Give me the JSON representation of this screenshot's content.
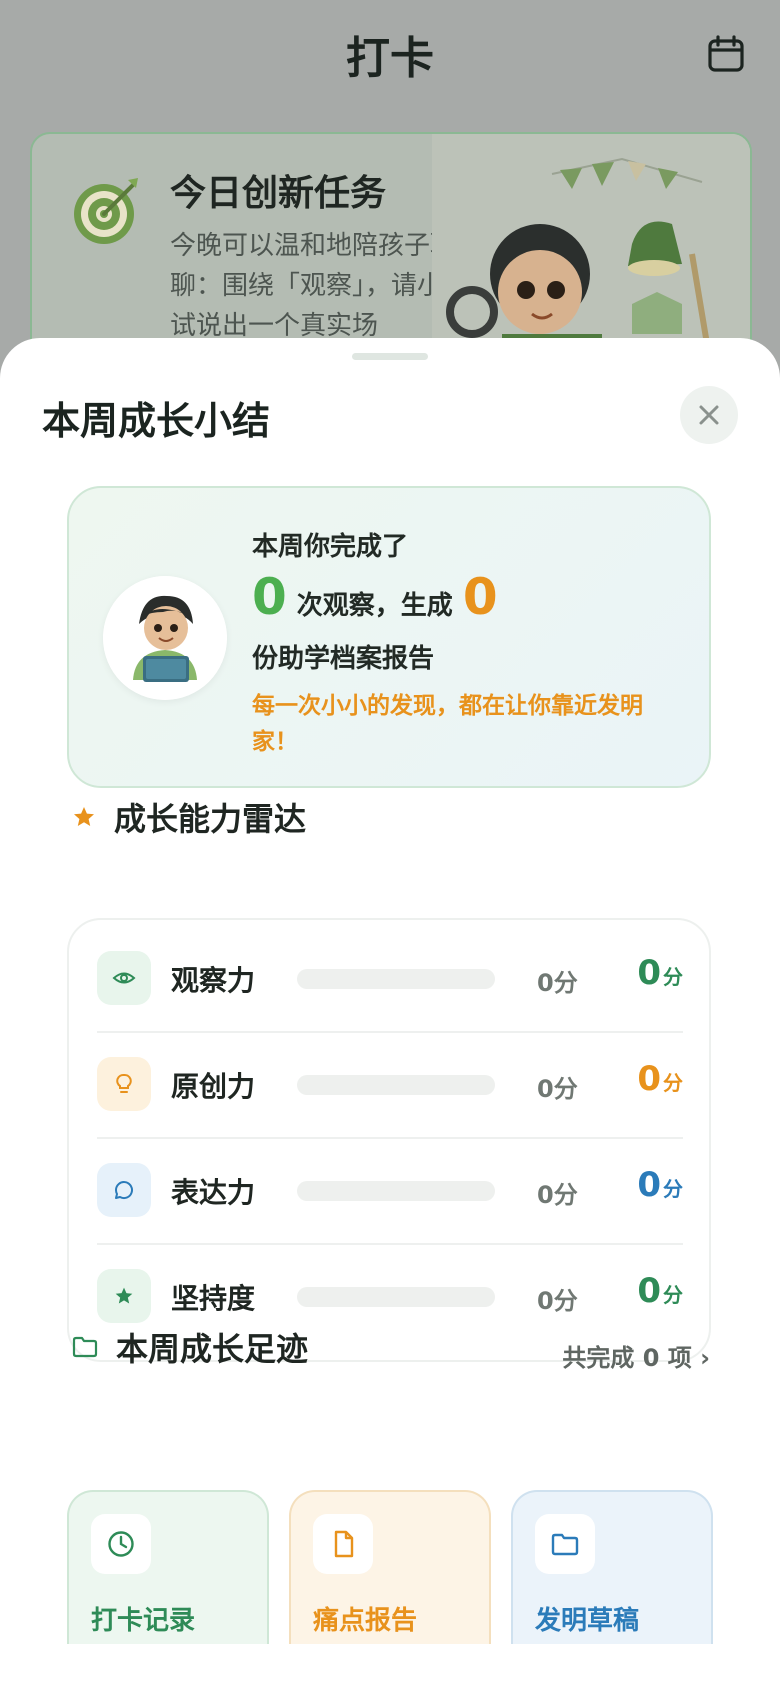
{
  "background": {
    "title": "打卡",
    "calendar_icon": "calendar-icon",
    "task_card": {
      "title": "今日创新任务",
      "text": "今晚可以温和地陪孩子聊聊：围绕「观察」，请小测试说出一个真实场"
    }
  },
  "sheet": {
    "title": "本周成长小结",
    "close_icon": "close-icon",
    "summary": {
      "line1": "本周你完成了",
      "observations": "0",
      "mid_text": "次观察，生成",
      "reports": "0",
      "line3": "份助学档案报告",
      "encouragement": "每一次小小的发现，都在让你靠近发明家！"
    },
    "radar": {
      "title": "成长能力雷达",
      "items": [
        {
          "label": "观察力",
          "score_text": "0分",
          "value": "0",
          "unit": "分",
          "progress": 0,
          "color": "#2e8b57",
          "icon": "eye-icon"
        },
        {
          "label": "原创力",
          "score_text": "0分",
          "value": "0",
          "unit": "分",
          "progress": 0,
          "color": "#e8921c",
          "icon": "lightbulb-icon"
        },
        {
          "label": "表达力",
          "score_text": "0分",
          "value": "0",
          "unit": "分",
          "progress": 0,
          "color": "#2b7bb9",
          "icon": "chat-bubble-icon"
        },
        {
          "label": "坚持度",
          "score_text": "0分",
          "value": "0",
          "unit": "分",
          "progress": 0,
          "color": "#2e8b57",
          "icon": "star-icon"
        }
      ]
    },
    "footprint": {
      "title": "本周成长足迹",
      "total_link": "共完成 0 项 ›",
      "tiles": [
        {
          "label": "打卡记录",
          "icon": "clock-icon",
          "color": "#2e8b57"
        },
        {
          "label": "痛点报告",
          "icon": "document-icon",
          "color": "#e8921c"
        },
        {
          "label": "发明草稿",
          "icon": "folder-icon",
          "color": "#2b7bb9"
        }
      ]
    }
  },
  "colors": {
    "green": "#4caf50",
    "orange": "#e8921c",
    "blue": "#2b7bb9",
    "overlay": "#a7aaa8"
  }
}
